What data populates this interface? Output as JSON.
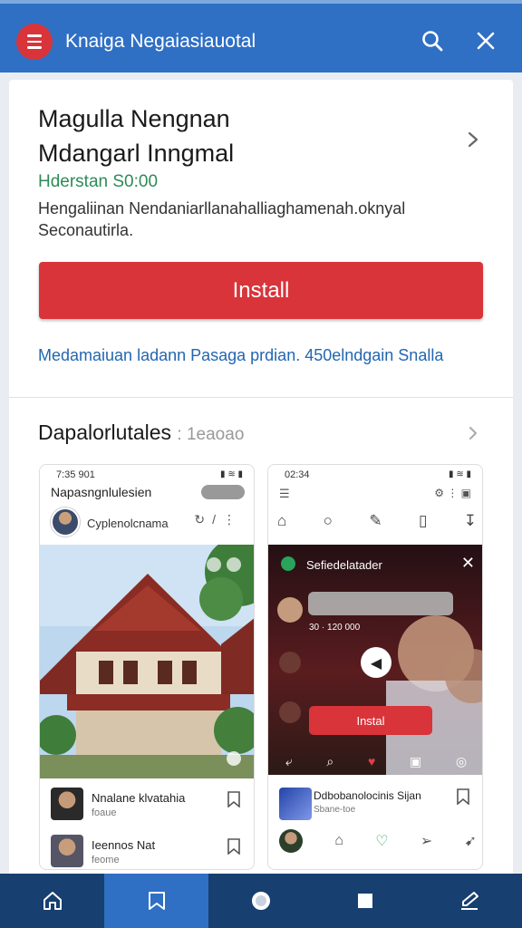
{
  "topbar": {
    "title": "Knaiga Negaiasiauotal"
  },
  "app": {
    "name_line1": "Magulla Nengnan",
    "name_line2": "Mdangarl Inngmal",
    "price": "Hderstan S0:00",
    "description": "Hengaliinan Nendaniarllanahalliaghamenah.oknyal Seconautirla.",
    "install_label": "Install",
    "link_text": "Medamaiuan ladann Pasaga prdian. 450elndgain Snalla"
  },
  "screenshots": {
    "title": "Dapalorlutales",
    "subtitle": ": 1eaoao",
    "shot1": {
      "time": "7:35 901",
      "header": "Napasngnlulesien",
      "author": "Cyplenolcnama",
      "row1_name": "Nnalane klvatahia",
      "row1_sub": "foaue",
      "row2_name": "Ieennos Nat",
      "row2_sub": "feome"
    },
    "shot2": {
      "time": "02:34",
      "video_title": "Sefiedelatader",
      "overlay_time": "30 · 120 000",
      "install_label": "Instal",
      "row_title": "Ddbobanolocinis Sijan",
      "row_sub": "Sbane-toe"
    }
  },
  "colors": {
    "topbar": "#2f6fc4",
    "accent_red": "#d8343a",
    "bottom_nav": "#173f70",
    "price_green": "#2e8b57",
    "link_blue": "#2366b0"
  },
  "bottom_nav": [
    "home-icon",
    "bookmark-icon",
    "circle-icon",
    "square-icon",
    "edit-icon"
  ]
}
